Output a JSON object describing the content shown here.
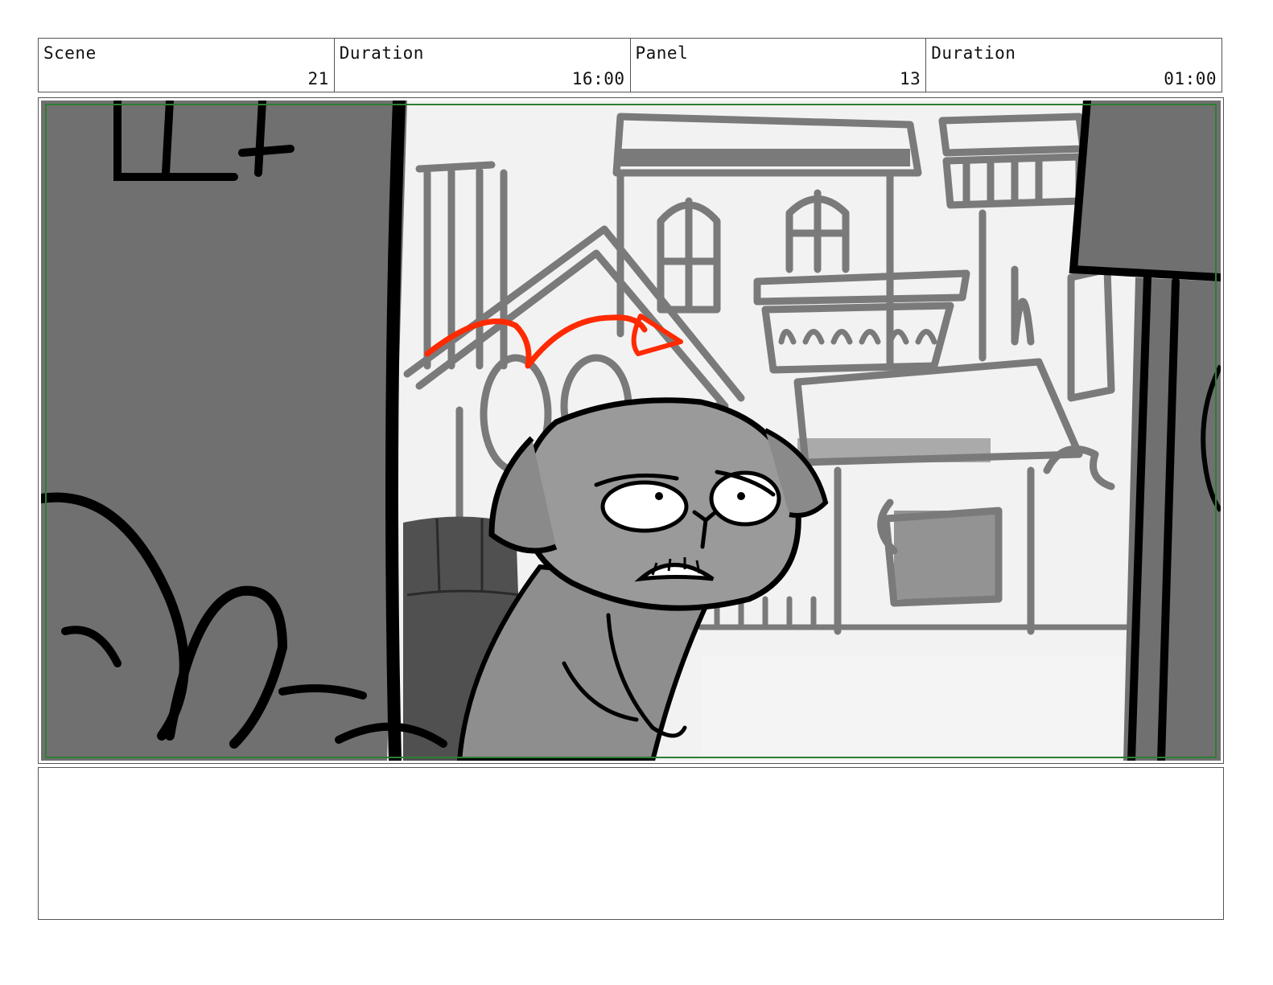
{
  "header": {
    "cells": [
      {
        "label": "Scene",
        "value": "21"
      },
      {
        "label": "Duration",
        "value": "16:00"
      },
      {
        "label": "Panel",
        "value": "13"
      },
      {
        "label": "Duration",
        "value": "01:00"
      }
    ]
  },
  "notes": {
    "text": ""
  },
  "colors": {
    "safe_frame": "#2e7d32",
    "motion_arrow": "#ff2a00",
    "foreground_wall": "#707070",
    "background_lines": "#7a7a7a",
    "sky": "#f2f2f2"
  }
}
